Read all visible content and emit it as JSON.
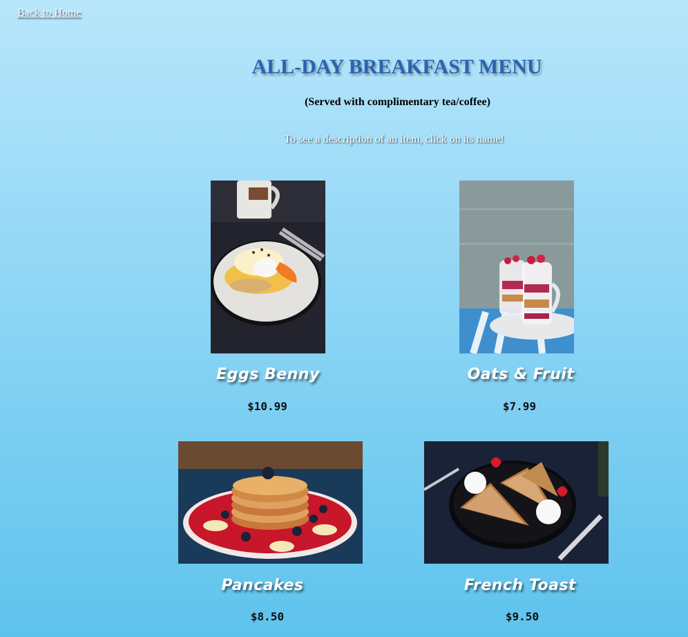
{
  "nav": {
    "back_label": "Back to Home"
  },
  "header": {
    "title": "ALL-DAY BREAKFAST MENU",
    "subtitle": "(Served with complimentary tea/coffee)",
    "hint": "To see a description of an item, click on its name!"
  },
  "menu": {
    "items": [
      {
        "name": "Eggs Benny",
        "price": "$10.99",
        "image": "eggs-benedict-photo"
      },
      {
        "name": "Oats & Fruit",
        "price": "$7.99",
        "image": "oats-fruit-parfait-photo"
      },
      {
        "name": "Pancakes",
        "price": "$8.50",
        "image": "pancake-stack-photo"
      },
      {
        "name": "French Toast",
        "price": "$9.50",
        "image": "french-toast-photo"
      }
    ]
  },
  "colors": {
    "background_top": "#b8e6fb",
    "background_bottom": "#5ec3ec",
    "title": "#2a63b0"
  }
}
